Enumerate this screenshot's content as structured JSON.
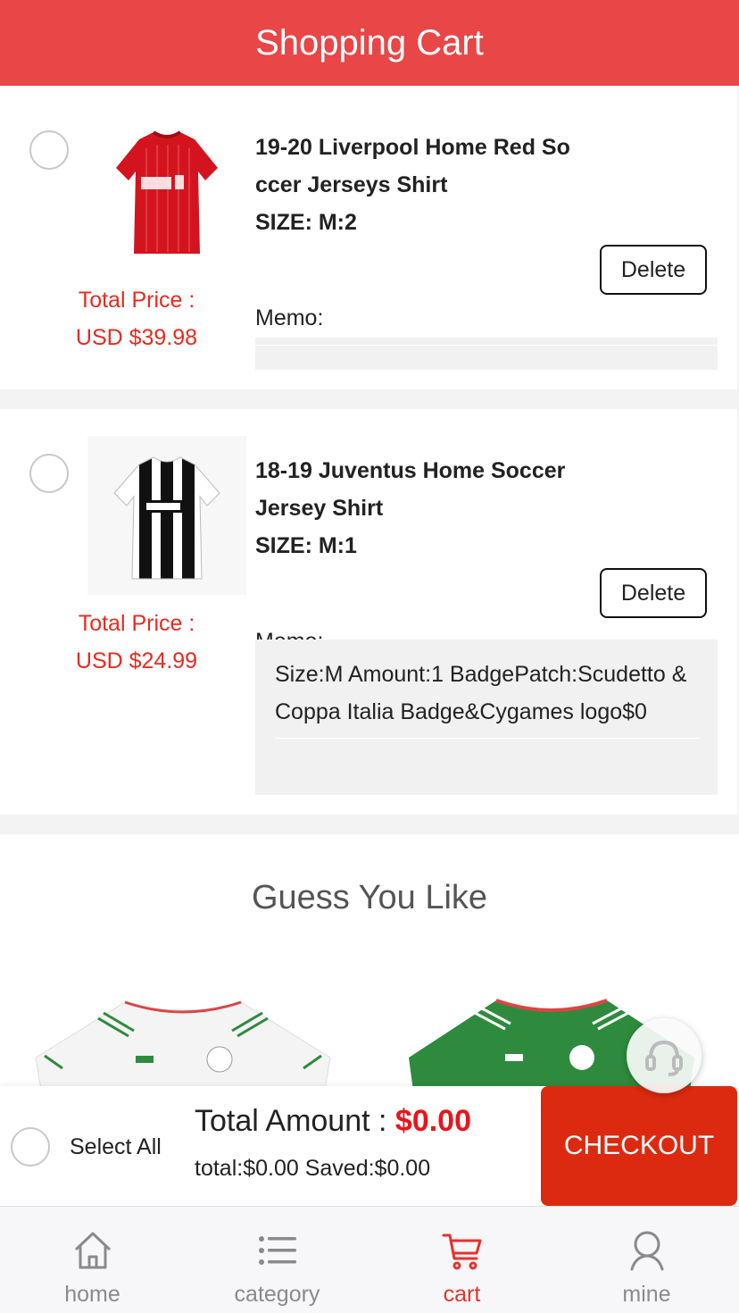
{
  "header": {
    "title": "Shopping Cart"
  },
  "cart_items": [
    {
      "title": "19-20 Liverpool Home Red So ccer Jerseys Shirt",
      "size": "SIZE: M:2",
      "price_label": "Total Price :",
      "price": "USD $39.98",
      "delete_label": "Delete",
      "memo_label": "Memo:",
      "memo": ""
    },
    {
      "title": "18-19 Juventus Home Soccer Jersey Shirt",
      "size": "SIZE: M:1",
      "price_label": "Total Price :",
      "price": "USD $24.99",
      "delete_label": "Delete",
      "memo_label": "Memo:",
      "memo": "Size:M  Amount:1 BadgePatch:Scudetto & Coppa Italia Badge&Cygames logo$0"
    }
  ],
  "recommendations": {
    "title": "Guess You Like"
  },
  "checkout": {
    "select_all": "Select All",
    "total_label": "Total Amount : ",
    "total_value": "$0.00",
    "sub": "total:$0.00 Saved:$0.00",
    "button": "CHECKOUT"
  },
  "tabs": [
    {
      "label": "home",
      "icon": "home-icon"
    },
    {
      "label": "category",
      "icon": "list-icon"
    },
    {
      "label": "cart",
      "icon": "cart-icon",
      "active": true
    },
    {
      "label": "mine",
      "icon": "user-icon"
    }
  ],
  "colors": {
    "brand": "#e84647",
    "price": "#e82a20",
    "checkout": "#dc2a10",
    "active_tab": "#e8312a"
  }
}
